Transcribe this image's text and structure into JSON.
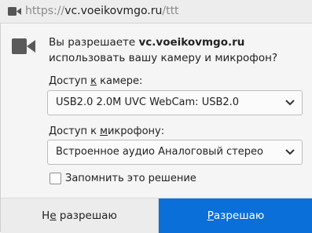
{
  "urlbar": {
    "icon": "camera-icon",
    "url_prefix": "https://",
    "url_host": "vc.voeikovmgo.ru",
    "url_path": "/ttt"
  },
  "prompt": {
    "icon": "camera-icon",
    "message_before": "Вы разрешаете ",
    "message_host": "vc.voeikovmgo.ru",
    "message_after": " использовать вашу камеру и микрофон?",
    "camera_label_prefix": "Доступ ",
    "camera_label_accesskey": "к",
    "camera_label_suffix": " камере:",
    "camera_selected": "USB2.0 2.0M UVC WebCam: USB2.0",
    "mic_label_prefix": "Доступ к ",
    "mic_label_accesskey": "м",
    "mic_label_suffix": "икрофону:",
    "mic_selected": "Встроенное аудио Аналоговый стерео",
    "remember_label": "Запомнить это решение",
    "remember_checked": false
  },
  "buttons": {
    "deny_prefix": "Н",
    "deny_accesskey": "е",
    "deny_suffix": " разрешаю",
    "allow_accesskey": "Р",
    "allow_suffix": "азрешаю",
    "allow_color": "#0a6fd8"
  }
}
